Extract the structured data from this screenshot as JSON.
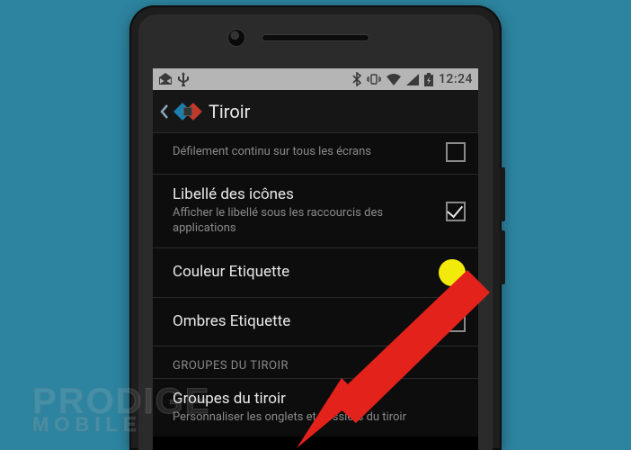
{
  "statusbar": {
    "time": "12:24",
    "icons_left": [
      "mail-open-icon",
      "usb-icon"
    ],
    "icons_right": [
      "bluetooth-icon",
      "vibrate-icon",
      "wifi-icon",
      "signal-icon",
      "battery-charging-icon"
    ]
  },
  "actionbar": {
    "title": "Tiroir"
  },
  "settings": {
    "items": [
      {
        "title": "",
        "sub": "Défilement continu sur tous les écrans",
        "control": "checkbox",
        "checked": false
      },
      {
        "title": "Libellé des icônes",
        "sub": "Afficher le libellé sous les raccourcis des applications",
        "control": "checkbox",
        "checked": true
      },
      {
        "title": "Couleur Etiquette",
        "sub": "",
        "control": "color",
        "color": "#f2ea0a"
      },
      {
        "title": "Ombres Etiquette",
        "sub": "",
        "control": "checkbox",
        "checked": false
      }
    ],
    "section_header": "GROUPES DU TIROIR",
    "group_item": {
      "title": "Groupes du tiroir",
      "sub": "Personnaliser les onglets et dossiers du tiroir"
    }
  },
  "watermark": {
    "line1": "PRODIGE",
    "line2": "MOBILE"
  }
}
